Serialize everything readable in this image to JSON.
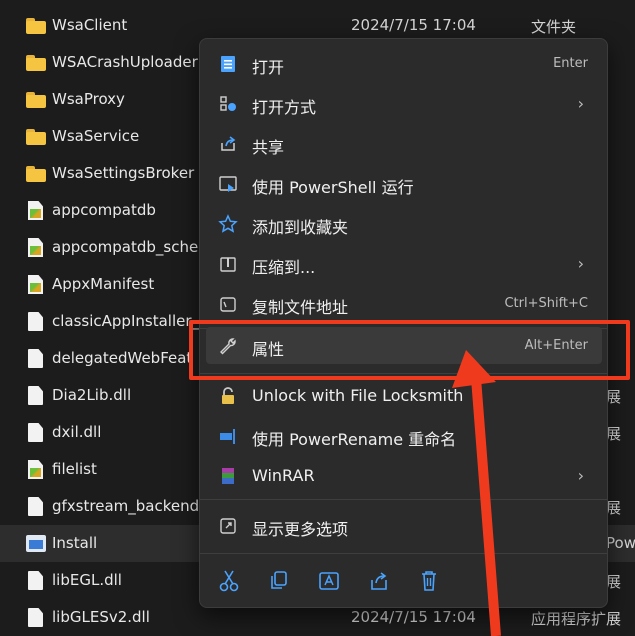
{
  "files": [
    {
      "name": "WsaClient",
      "date": "2024/7/15 17:04",
      "type": "文件夹",
      "icon": "folder-icon"
    },
    {
      "name": "WSACrashUploader",
      "date": "",
      "type": "",
      "icon": "folder-icon"
    },
    {
      "name": "WsaProxy",
      "date": "",
      "type": "",
      "icon": "folder-icon"
    },
    {
      "name": "WsaService",
      "date": "",
      "type": "",
      "icon": "folder-icon"
    },
    {
      "name": "WsaSettingsBroker",
      "date": "",
      "type": "",
      "icon": "folder-icon"
    },
    {
      "name": "appcompatdb",
      "date": "",
      "type": "",
      "icon": "xml-file-icon"
    },
    {
      "name": "appcompatdb_sche",
      "date": "",
      "type": "",
      "icon": "xml-file-icon"
    },
    {
      "name": "AppxManifest",
      "date": "",
      "type": "",
      "icon": "xml-file-icon"
    },
    {
      "name": "classicAppInstaller_",
      "date": "",
      "type": "",
      "icon": "file-icon"
    },
    {
      "name": "delegatedWebFeat",
      "date": "",
      "type": "",
      "icon": "file-icon"
    },
    {
      "name": "Dia2Lib.dll",
      "date": "",
      "type": "展",
      "icon": "dll-file-icon"
    },
    {
      "name": "dxil.dll",
      "date": "",
      "type": "展",
      "icon": "dll-file-icon"
    },
    {
      "name": "filelist",
      "date": "",
      "type": "",
      "icon": "xml-file-icon"
    },
    {
      "name": "gfxstream_backend.",
      "date": "",
      "type": "展",
      "icon": "dll-file-icon"
    },
    {
      "name": "Install",
      "date": "",
      "type": "Powe",
      "icon": "installer-icon"
    },
    {
      "name": "libEGL.dll",
      "date": "",
      "type": "展",
      "icon": "dll-file-icon"
    },
    {
      "name": "libGLESv2.dll",
      "date": "2024/7/15 17:04",
      "type": "应用程序扩展",
      "icon": "dll-file-icon"
    }
  ],
  "menu": {
    "items": [
      {
        "label": "打开",
        "key": "Enter",
        "icon": "open-icon",
        "submenu": false
      },
      {
        "label": "打开方式",
        "key": "",
        "icon": "open-with-icon",
        "submenu": true
      },
      {
        "label": "共享",
        "key": "",
        "icon": "share-icon",
        "submenu": false
      },
      {
        "label": "使用 PowerShell 运行",
        "key": "",
        "icon": "powershell-icon",
        "submenu": false
      },
      {
        "label": "添加到收藏夹",
        "key": "",
        "icon": "star-icon",
        "submenu": false
      },
      {
        "label": "压缩到...",
        "key": "",
        "icon": "compress-icon",
        "submenu": true
      },
      {
        "label": "复制文件地址",
        "key": "Ctrl+Shift+C",
        "icon": "copy-path-icon",
        "submenu": false
      },
      {
        "label": "属性",
        "key": "Alt+Enter",
        "icon": "wrench-icon",
        "submenu": false
      },
      {
        "label": "Unlock with File Locksmith",
        "key": "",
        "icon": "lock-icon",
        "submenu": false
      },
      {
        "label": "使用 PowerRename 重命名",
        "key": "",
        "icon": "powerrename-icon",
        "submenu": false
      },
      {
        "label": "WinRAR",
        "key": "",
        "icon": "winrar-icon",
        "submenu": true
      },
      {
        "label": "显示更多选项",
        "key": "",
        "icon": "more-options-icon",
        "submenu": false
      }
    ],
    "arrow_glyph": "›",
    "bottom_actions": [
      "cut-icon",
      "copy-icon",
      "rename-icon",
      "share-icon",
      "delete-icon"
    ]
  },
  "colors": {
    "highlight": "#f03a1e",
    "accent": "#4aa3ff",
    "folder": "#f5c542"
  }
}
